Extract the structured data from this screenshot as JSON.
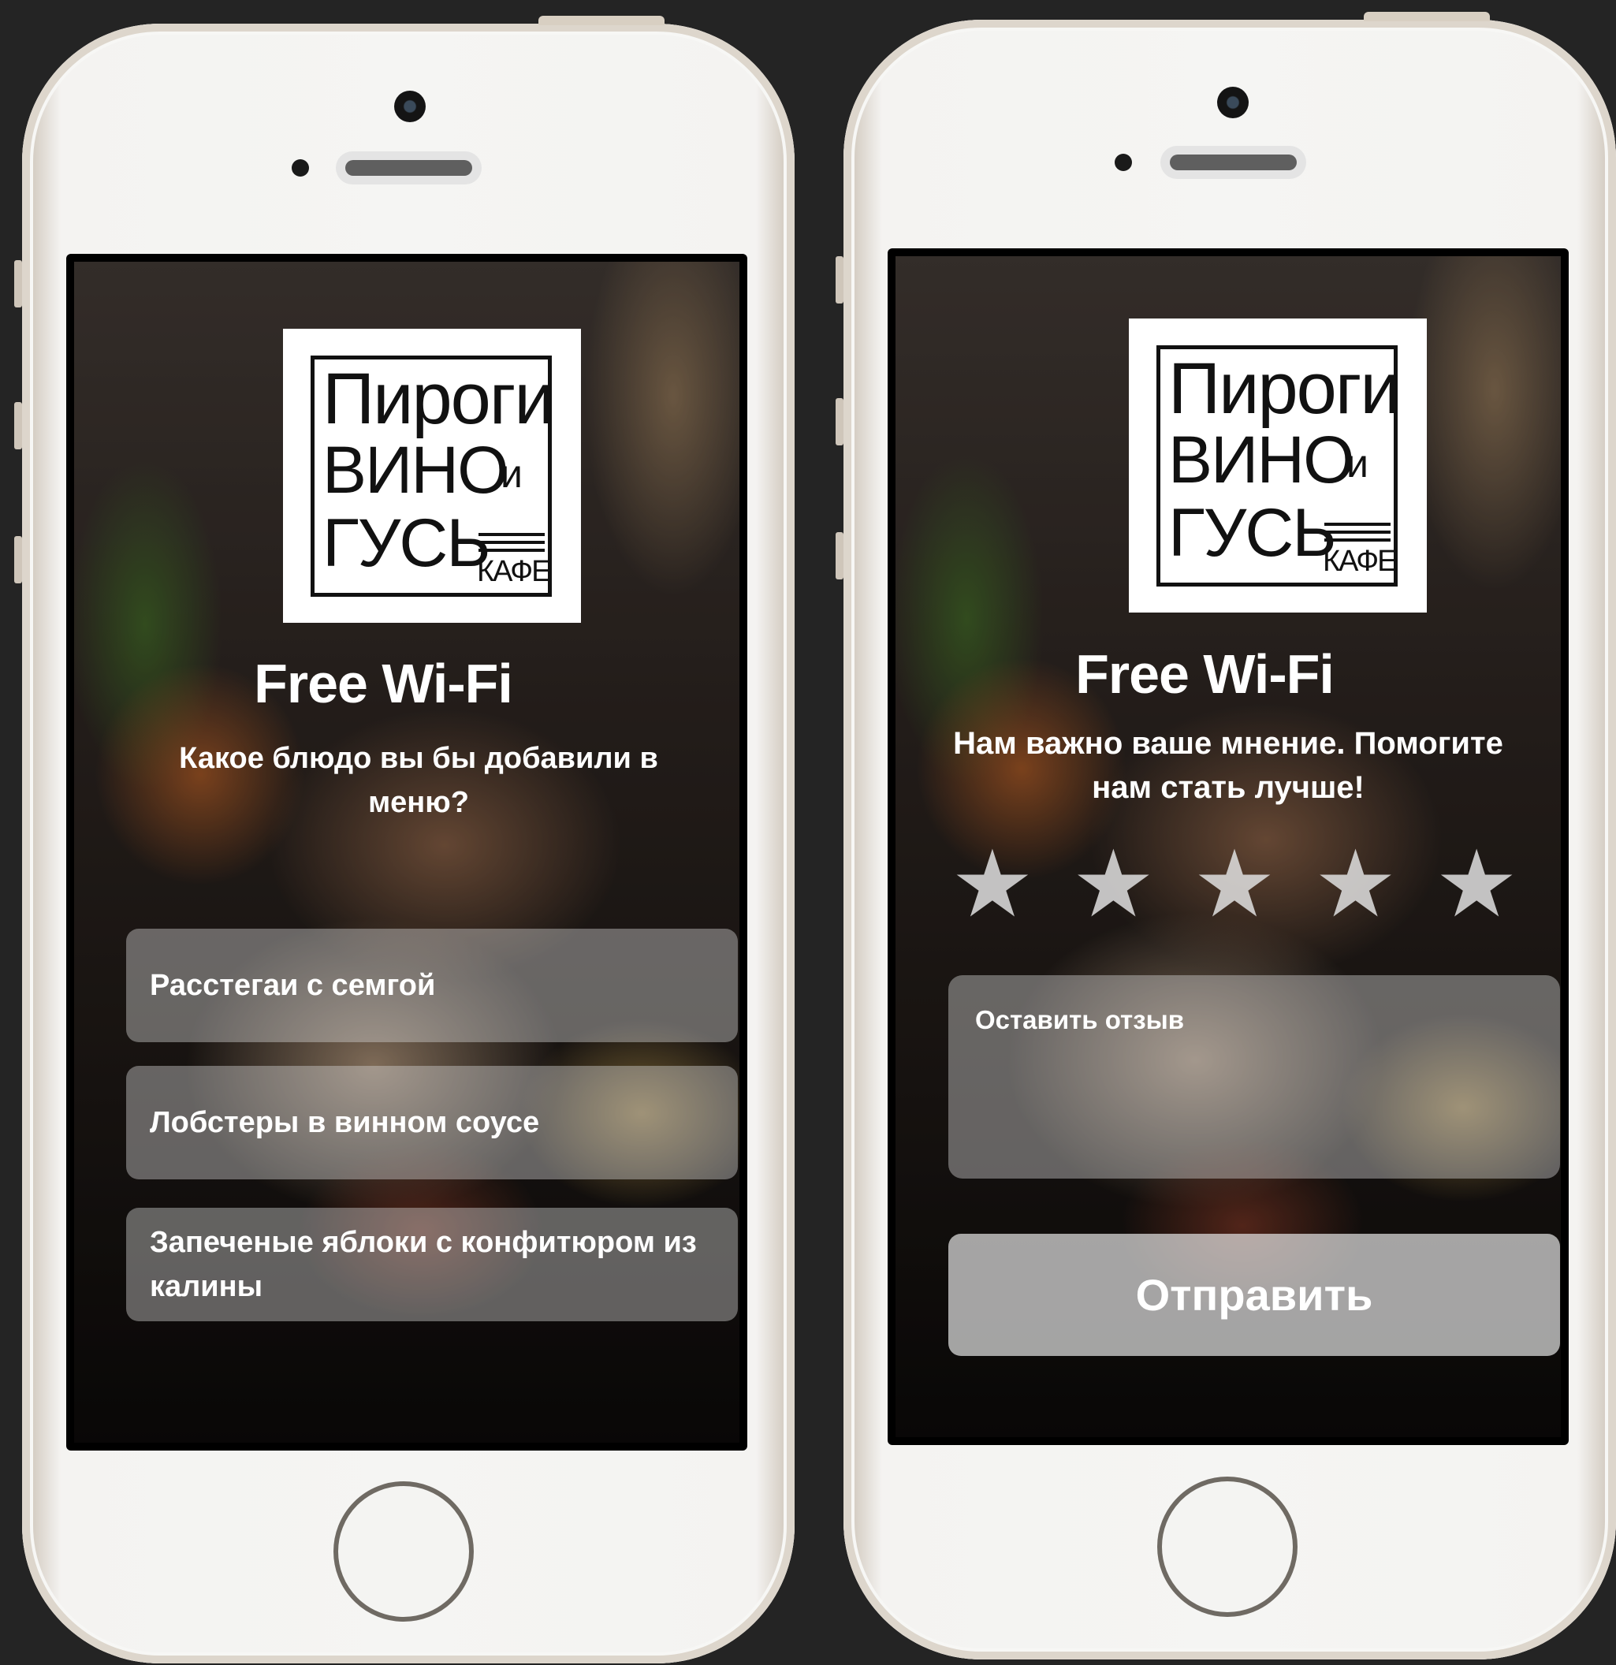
{
  "brand": {
    "logo_line1": "Пироги",
    "logo_line2": "ВИНО",
    "logo_and": "и",
    "logo_line3": "ГУСЬ",
    "logo_cafe": "КАФЕ"
  },
  "screen_poll": {
    "title": "Free Wi-Fi",
    "question": "Какое блюдо вы бы добавили в меню?",
    "options": [
      {
        "label": "Расстегаи с семгой"
      },
      {
        "label": "Лобстеры в винном соусе"
      },
      {
        "label": "Запеченые яблоки с конфитюром из калины"
      }
    ]
  },
  "screen_feedback": {
    "title": "Free Wi-Fi",
    "prompt": "Нам важно ваше мнение. Помогите нам стать лучше!",
    "rating": {
      "max": 5,
      "selected": 0
    },
    "stars": [
      "★",
      "★",
      "★",
      "★",
      "★"
    ],
    "feedback_placeholder": "Оставить отзыв",
    "submit_label": "Отправить"
  },
  "colors": {
    "page_background": "#242424",
    "device_body": "#f5f5f3",
    "text": "#ffffff",
    "field_overlay": "rgba(215,215,215,0.42)"
  }
}
